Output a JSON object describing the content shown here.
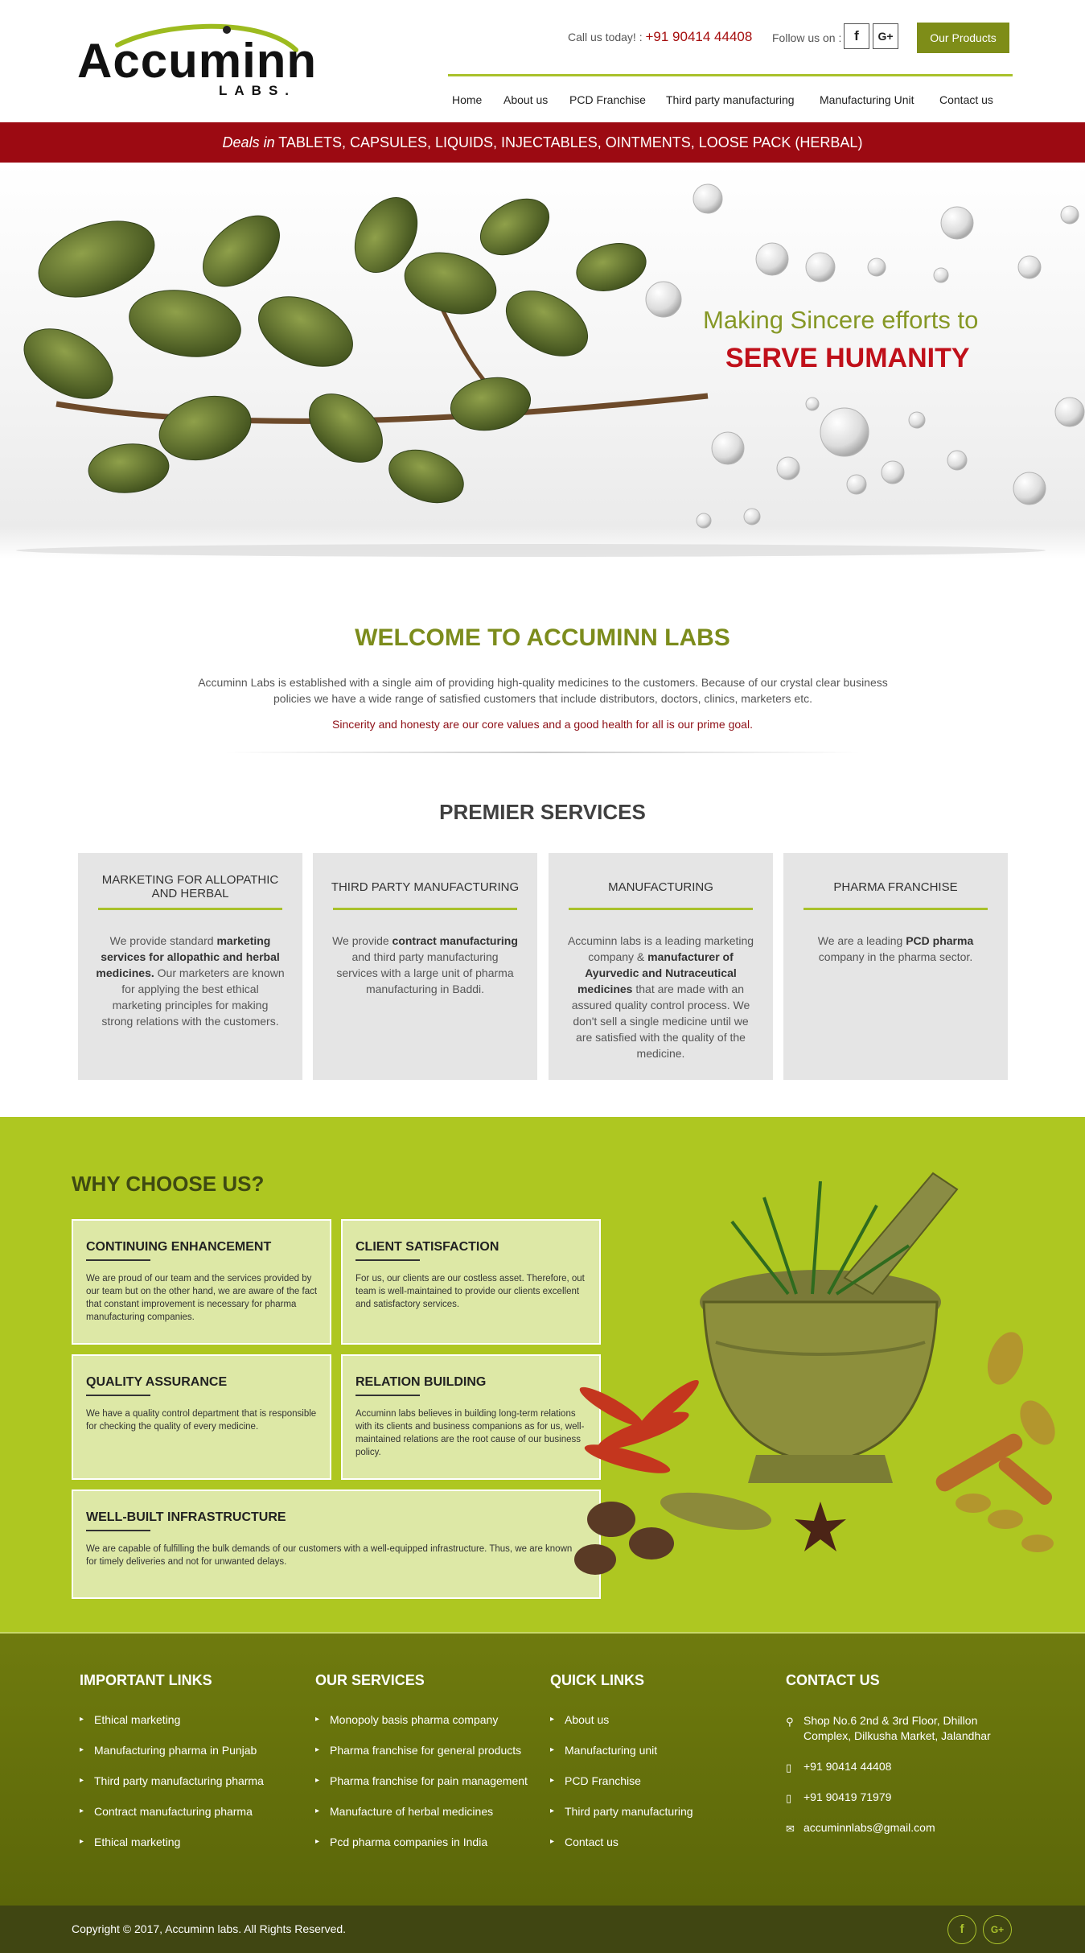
{
  "brand": {
    "logo_main": "Accuminn",
    "logo_sub": "LABS."
  },
  "header": {
    "call_label": "Call us today! :",
    "call_phone": "+91 90414 44408",
    "follow_label": "Follow us on :",
    "facebook_icon": "f",
    "googleplus_icon": "G+",
    "products_button": "Our Products"
  },
  "nav": {
    "items": [
      {
        "label": "Home"
      },
      {
        "label": "About us"
      },
      {
        "label": "PCD Franchise"
      },
      {
        "label": "Third party manufacturing"
      },
      {
        "label": "Manufacturing Unit"
      },
      {
        "label": "Contact us"
      }
    ]
  },
  "deals": {
    "prefix": "Deals in",
    "text": "TABLETS, CAPSULES, LIQUIDS, INJECTABLES, OINTMENTS, LOOSE PACK (HERBAL)"
  },
  "hero": {
    "line1": "Making  Sincere efforts to",
    "line2": "SERVE HUMANITY"
  },
  "welcome": {
    "title": "WELCOME TO ACCUMINN LABS",
    "text": "Accuminn Labs is established with a single aim of providing high-quality medicines to the customers. Because of our crystal clear business policies we have a wide range of satisfied customers that include distributors, doctors, clinics, marketers etc.",
    "goal": "Sincerity and honesty are our core values and a good health for all is our prime goal."
  },
  "services": {
    "title": "PREMIER SERVICES",
    "items": [
      {
        "title": "MARKETING FOR ALLOPATHIC AND HERBAL",
        "pre": "We provide standard ",
        "bold": "marketing services for allopathic and herbal medicines.",
        "post": " Our marketers are known for applying the best ethical marketing principles for making strong relations with the customers."
      },
      {
        "title": "THIRD PARTY MANUFACTURING",
        "pre": "We provide ",
        "bold": "contract manufacturing",
        "post": " and third party manufacturing services with a large unit of pharma manufacturing in Baddi."
      },
      {
        "title": "MANUFACTURING",
        "pre": "Accuminn labs is a leading marketing company & ",
        "bold": "manufacturer of Ayurvedic and Nutraceutical medicines",
        "post": " that are made with an assured quality control process. We don't sell a single medicine until we are satisfied with the quality of the medicine."
      },
      {
        "title": "PHARMA FRANCHISE",
        "pre": "We are a leading ",
        "bold": "PCD pharma",
        "post": " company in the pharma sector."
      }
    ]
  },
  "why": {
    "title": "WHY CHOOSE US?",
    "cards": [
      {
        "title": "CONTINUING ENHANCEMENT",
        "text": "We are proud of our team and the services provided by our team but on the other hand, we are aware of the fact that constant improvement is necessary for pharma manufacturing companies."
      },
      {
        "title": "CLIENT SATISFACTION",
        "text": "For us, our clients are our costless asset. Therefore, out team is well-maintained to provide our clients excellent and satisfactory services."
      },
      {
        "title": "QUALITY ASSURANCE",
        "text": "We have a quality control department that is responsible for checking the quality of every medicine."
      },
      {
        "title": "RELATION BUILDING",
        "text": "Accuminn labs believes in building long-term relations with its clients and business companions as for us, well-maintained relations are the root cause of our business policy."
      },
      {
        "title": "WELL-BUILT INFRASTRUCTURE",
        "text": "We are capable of fulfilling the bulk demands of our customers with a well-equipped infrastructure. Thus, we are known for timely deliveries and not for unwanted delays."
      }
    ]
  },
  "footer": {
    "important_links": {
      "title": "IMPORTANT LINKS",
      "items": [
        "Ethical marketing",
        "Manufacturing pharma in Punjab",
        "Third party manufacturing pharma",
        "Contract manufacturing pharma",
        "Ethical marketing"
      ]
    },
    "our_services": {
      "title": "OUR SERVICES",
      "items": [
        "Monopoly basis pharma company",
        "Pharma franchise for general products",
        "Pharma franchise for pain management",
        "Manufacture of herbal medicines",
        "Pcd pharma companies in India"
      ]
    },
    "quick_links": {
      "title": "QUICK LINKS",
      "items": [
        "About us",
        "Manufacturing unit",
        "PCD Franchise",
        "Third party manufacturing",
        "Contact us"
      ]
    },
    "contact": {
      "title": "CONTACT US",
      "address": "Shop No.6 2nd & 3rd Floor, Dhillon Complex, Dilkusha Market, Jalandhar",
      "phone1": "+91 90414 44408",
      "phone2": "+91 90419 71979",
      "email": "accuminnlabs@gmail.com"
    },
    "copyright": "Copyright © 2017, Accuminn labs. All Rights Reserved."
  },
  "colors": {
    "accent_green": "#a9c12b",
    "olive": "#7e8d18",
    "deals_red": "#9c0a12",
    "hero_red": "#c0101a",
    "footer_green": "#6f7b0e"
  },
  "icons": {
    "link_arrow": "▸",
    "location": "location-icon",
    "mobile": "mobile-icon",
    "mail": "envelope-icon"
  }
}
